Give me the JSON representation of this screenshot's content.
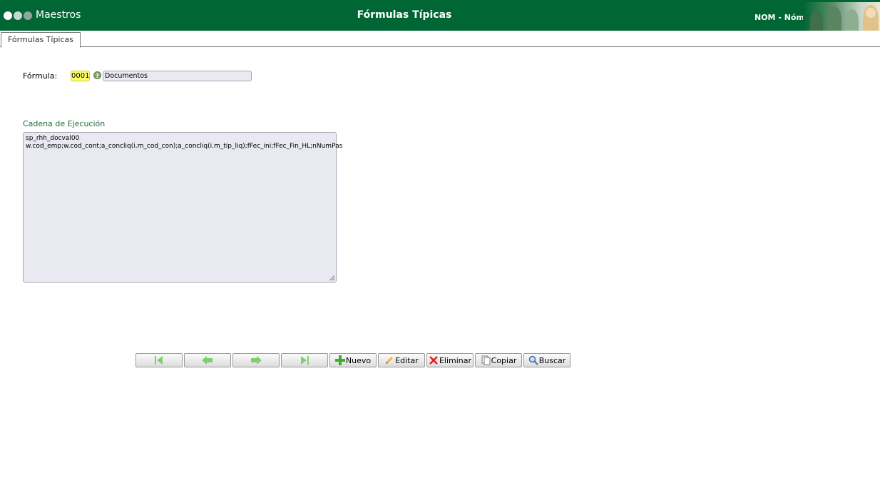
{
  "header": {
    "app_name": "Maestros",
    "title": "Fórmulas Típicas",
    "module": "NOM - Nómina"
  },
  "tabs": [
    {
      "label": "Fórmulas Típicas"
    }
  ],
  "form": {
    "formula_label": "Fórmula:",
    "formula_code": "0001",
    "formula_description": "Documentos",
    "section_title": "Cadena de Ejecución",
    "execution_lines": [
      "sp_rhh_docval00",
      "w.cod_emp;w.cod_cont;a_concliq(i.m_cod_con);a_concliq(i.m_tip_liq);fFec_ini;fFec_Fin_HL;nNumPas"
    ]
  },
  "toolbar": {
    "first_icon": "first-record-icon",
    "prev_icon": "previous-record-icon",
    "next_icon": "next-record-icon",
    "last_icon": "last-record-icon",
    "new_label": "Nuevo",
    "edit_label": "Editar",
    "delete_label": "Eliminar",
    "copy_label": "Copiar",
    "search_label": "Buscar"
  },
  "colors": {
    "header_bg": "#006633",
    "code_highlight": "#ffff66",
    "field_bg": "#e8e9f1",
    "section_title": "#1b6d3a"
  }
}
